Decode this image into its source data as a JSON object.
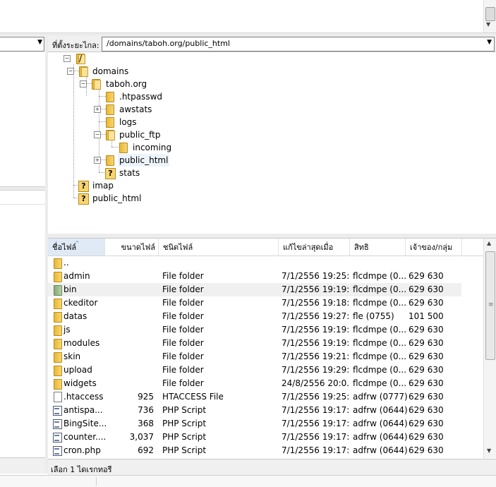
{
  "remote": {
    "label": "ที่ตั้งระยะไกล:",
    "path": "/domains/taboh.org/public_html"
  },
  "tree": [
    {
      "label": "/",
      "icon": "folder-open-icon"
    },
    {
      "label": "domains",
      "icon": "folder-open-icon"
    },
    {
      "label": "taboh.org",
      "icon": "folder-open-icon"
    },
    {
      "label": ".htpasswd",
      "icon": "folder-icon"
    },
    {
      "label": "awstats",
      "icon": "folder-icon"
    },
    {
      "label": "logs",
      "icon": "folder-icon"
    },
    {
      "label": "public_ftp",
      "icon": "folder-open-icon"
    },
    {
      "label": "incoming",
      "icon": "folder-icon"
    },
    {
      "label": "public_html",
      "icon": "folder-icon"
    },
    {
      "label": "stats",
      "icon": "unknown-icon"
    },
    {
      "label": "imap",
      "icon": "unknown-icon"
    },
    {
      "label": "public_html",
      "icon": "unknown-icon"
    }
  ],
  "columns": {
    "name": "ชื่อไฟล์",
    "size": "ขนาดไฟล์",
    "type": "ชนิดไฟล์",
    "modified": "แก้ไขล่าสุดเมื่อ",
    "perm": "สิทธิ",
    "owner": "เจ้าของ/กลุ่ม"
  },
  "files": [
    {
      "name": "..",
      "size": "",
      "type": "",
      "modified": "",
      "perm": "",
      "owner": "",
      "icon": "folder"
    },
    {
      "name": "admin",
      "size": "",
      "type": "File folder",
      "modified": "7/1/2556 19:25:...",
      "perm": "flcdmpe (0...",
      "owner": "629 630",
      "icon": "folder"
    },
    {
      "name": "bin",
      "size": "",
      "type": "File folder",
      "modified": "7/1/2556 19:19:...",
      "perm": "flcdmpe (0...",
      "owner": "629 630",
      "icon": "greenfolder"
    },
    {
      "name": "ckeditor",
      "size": "",
      "type": "File folder",
      "modified": "7/1/2556 19:18:...",
      "perm": "flcdmpe (0...",
      "owner": "629 630",
      "icon": "folder"
    },
    {
      "name": "datas",
      "size": "",
      "type": "File folder",
      "modified": "7/1/2556 19:27:...",
      "perm": "fle (0755)",
      "owner": "101 500",
      "icon": "folder"
    },
    {
      "name": "js",
      "size": "",
      "type": "File folder",
      "modified": "7/1/2556 19:19:...",
      "perm": "flcdmpe (0...",
      "owner": "629 630",
      "icon": "folder"
    },
    {
      "name": "modules",
      "size": "",
      "type": "File folder",
      "modified": "7/1/2556 19:19:...",
      "perm": "flcdmpe (0...",
      "owner": "629 630",
      "icon": "folder"
    },
    {
      "name": "skin",
      "size": "",
      "type": "File folder",
      "modified": "7/1/2556 19:21:...",
      "perm": "flcdmpe (0...",
      "owner": "629 630",
      "icon": "folder"
    },
    {
      "name": "upload",
      "size": "",
      "type": "File folder",
      "modified": "7/1/2556 19:29:...",
      "perm": "flcdmpe (0...",
      "owner": "629 630",
      "icon": "folder"
    },
    {
      "name": "widgets",
      "size": "",
      "type": "File folder",
      "modified": "24/8/2556 20:0...",
      "perm": "flcdmpe (0...",
      "owner": "629 630",
      "icon": "folder"
    },
    {
      "name": ".htaccess",
      "size": "925",
      "type": "HTACCESS File",
      "modified": "7/1/2556 19:25:...",
      "perm": "adfrw (0777)",
      "owner": "629 630",
      "icon": "file"
    },
    {
      "name": "antispa...",
      "size": "736",
      "type": "PHP Script",
      "modified": "7/1/2556 19:17:...",
      "perm": "adfrw (0644)",
      "owner": "629 630",
      "icon": "php"
    },
    {
      "name": "BingSite...",
      "size": "368",
      "type": "PHP Script",
      "modified": "7/1/2556 19:17:...",
      "perm": "adfrw (0644)",
      "owner": "629 630",
      "icon": "php"
    },
    {
      "name": "counter....",
      "size": "3,037",
      "type": "PHP Script",
      "modified": "7/1/2556 19:17:...",
      "perm": "adfrw (0644)",
      "owner": "629 630",
      "icon": "php"
    },
    {
      "name": "cron.php",
      "size": "692",
      "type": "PHP Script",
      "modified": "7/1/2556 19:17:...",
      "perm": "adfrw (0644)",
      "owner": "629 630",
      "icon": "php"
    }
  ],
  "status": {
    "text": "เลือก 1 ไดเรกทอรี"
  }
}
